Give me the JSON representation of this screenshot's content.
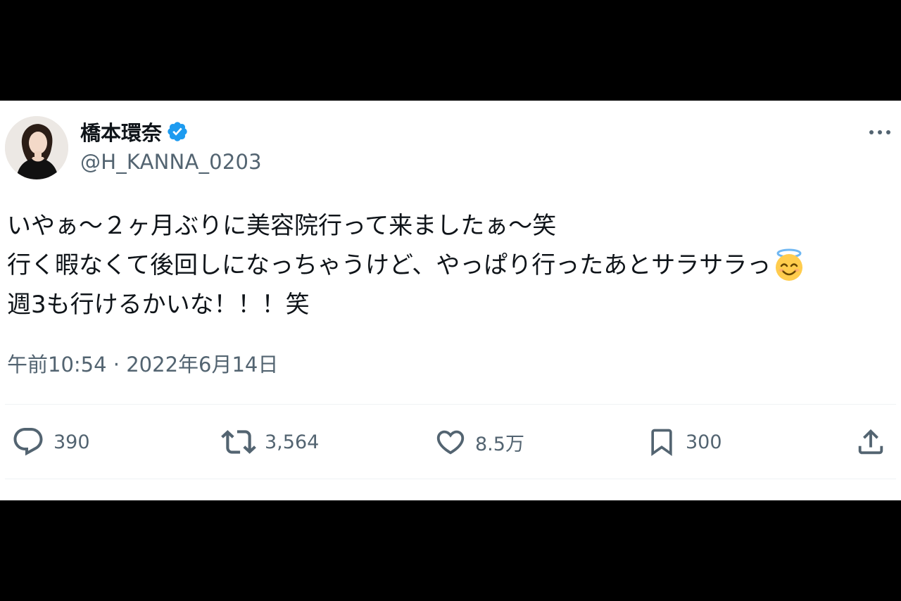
{
  "tweet": {
    "author": {
      "display_name": "橋本環奈",
      "handle": "@H_KANNA_0203",
      "verified_icon": "verified-badge-icon"
    },
    "text_lines": [
      "いやぁ〜２ヶ月ぶりに美容院行って来ましたぁ〜笑",
      "行く暇なくて後回しになっちゃうけど、やっぱり行ったあとサラサラっ",
      "週3も行けるかいな！！！笑"
    ],
    "emoji": "smiling-face-with-halo",
    "timestamp": "午前10:54 · 2022年6月14日",
    "actions": {
      "reply": {
        "icon": "reply-icon",
        "count": "390"
      },
      "retweet": {
        "icon": "retweet-icon",
        "count": "3,564"
      },
      "like": {
        "icon": "heart-icon",
        "count": "8.5万"
      },
      "bookmark": {
        "icon": "bookmark-icon",
        "count": "300"
      },
      "share": {
        "icon": "share-icon"
      }
    },
    "more_icon": "more-dots-icon"
  },
  "colors": {
    "primary_text": "#0f1419",
    "secondary_text": "#536471",
    "verified_blue": "#1d9bf0",
    "divider": "#eff3f4",
    "letterbox": "#000000"
  }
}
